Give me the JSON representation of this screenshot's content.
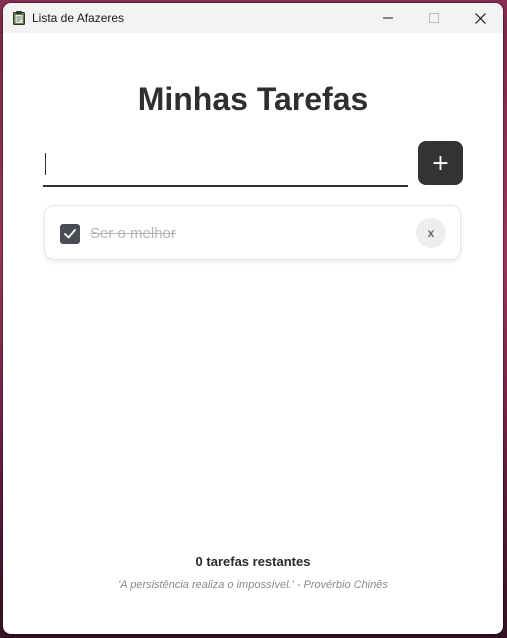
{
  "window": {
    "title": "Lista de Afazeres",
    "app_icon": "clipboard-icon"
  },
  "main": {
    "heading": "Minhas Tarefas",
    "input_value": "",
    "input_placeholder": "",
    "add_button_label": "+"
  },
  "tasks": [
    {
      "text": "Ser o melhor",
      "completed": true,
      "delete_label": "x"
    }
  ],
  "footer": {
    "remaining": "0 tarefas restantes",
    "quote": "'A persistência realiza o impossível.' - Provérbio Chinês"
  },
  "colors": {
    "accent": "#333333",
    "checkbox": "#4a4d54",
    "completed_text": "#b5b5b5"
  }
}
